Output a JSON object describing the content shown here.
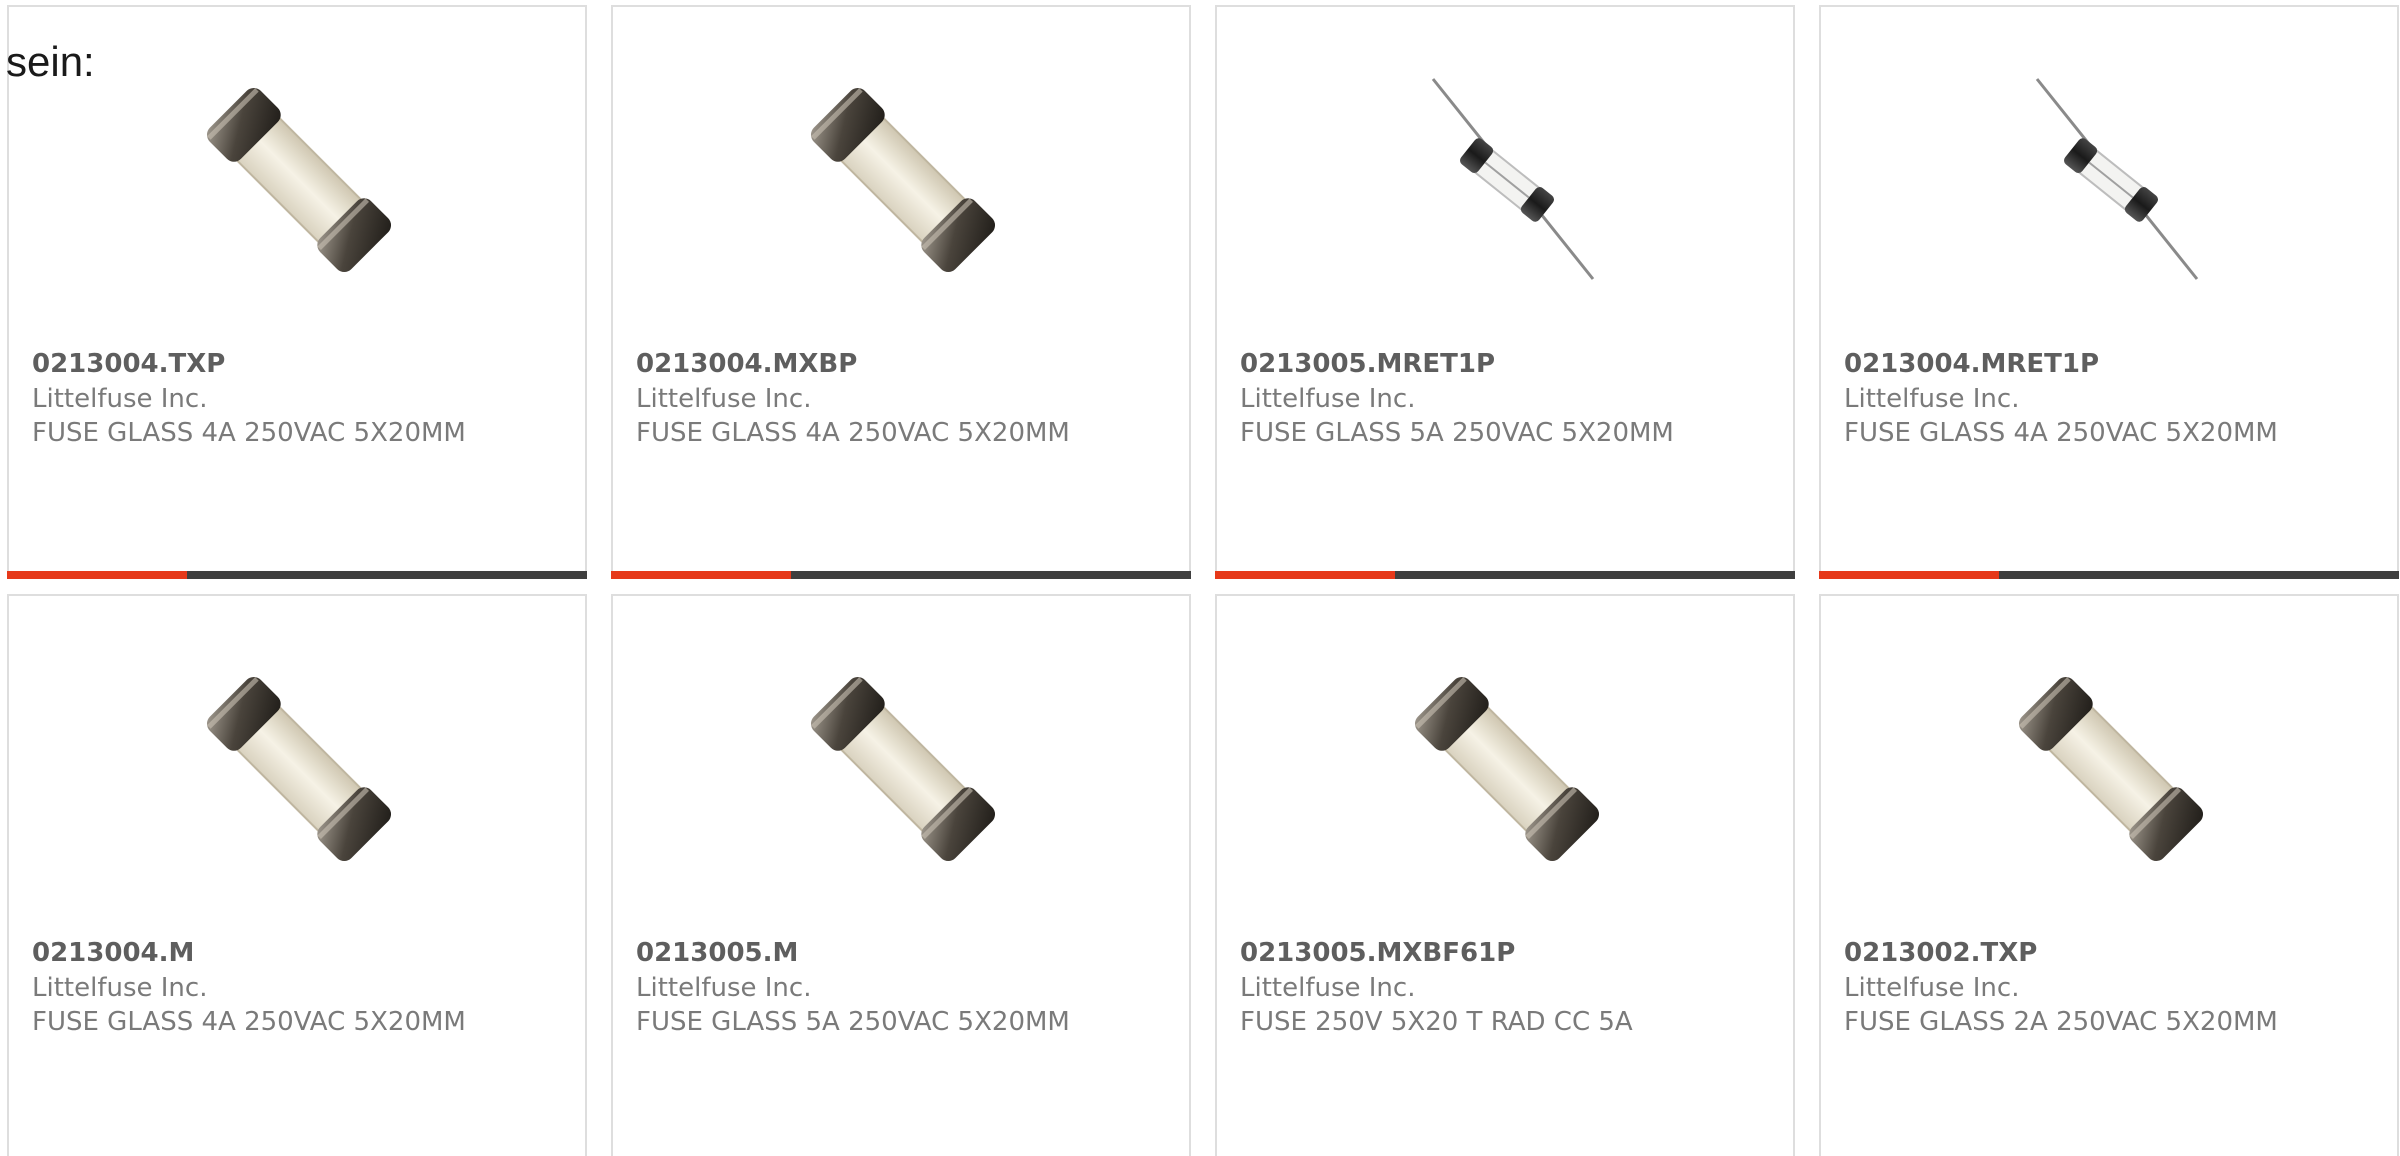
{
  "intro_text": "sein:",
  "colors": {
    "accent": "#e6391a",
    "track": "#3f3f3f",
    "card_border": "#dedede",
    "title_text": "#5e5e5e",
    "body_text": "#7a7a7a"
  },
  "products": [
    {
      "part_number": "0213004.TXP",
      "manufacturer": "Littelfuse Inc.",
      "description": "FUSE GLASS 4A 250VAC 5X20MM",
      "image_icon": "cartridge-fuse-icon",
      "progress": 0.31
    },
    {
      "part_number": "0213004.MXBP",
      "manufacturer": "Littelfuse Inc.",
      "description": "FUSE GLASS 4A 250VAC 5X20MM",
      "image_icon": "cartridge-fuse-icon",
      "progress": 0.31
    },
    {
      "part_number": "0213005.MRET1P",
      "manufacturer": "Littelfuse Inc.",
      "description": "FUSE GLASS 5A 250VAC 5X20MM",
      "image_icon": "axial-lead-fuse-icon",
      "progress": 0.31
    },
    {
      "part_number": "0213004.MRET1P",
      "manufacturer": "Littelfuse Inc.",
      "description": "FUSE GLASS 4A 250VAC 5X20MM",
      "image_icon": "axial-lead-fuse-icon",
      "progress": 0.31
    },
    {
      "part_number": "0213004.M",
      "manufacturer": "Littelfuse Inc.",
      "description": "FUSE GLASS 4A 250VAC 5X20MM",
      "image_icon": "cartridge-fuse-icon"
    },
    {
      "part_number": "0213005.M",
      "manufacturer": "Littelfuse Inc.",
      "description": "FUSE GLASS 5A 250VAC 5X20MM",
      "image_icon": "cartridge-fuse-icon"
    },
    {
      "part_number": "0213005.MXBF61P",
      "manufacturer": "Littelfuse Inc.",
      "description": "FUSE 250V 5X20 T RAD CC 5A",
      "image_icon": "cartridge-fuse-icon"
    },
    {
      "part_number": "0213002.TXP",
      "manufacturer": "Littelfuse Inc.",
      "description": "FUSE GLASS 2A 250VAC 5X20MM",
      "image_icon": "cartridge-fuse-icon"
    }
  ]
}
